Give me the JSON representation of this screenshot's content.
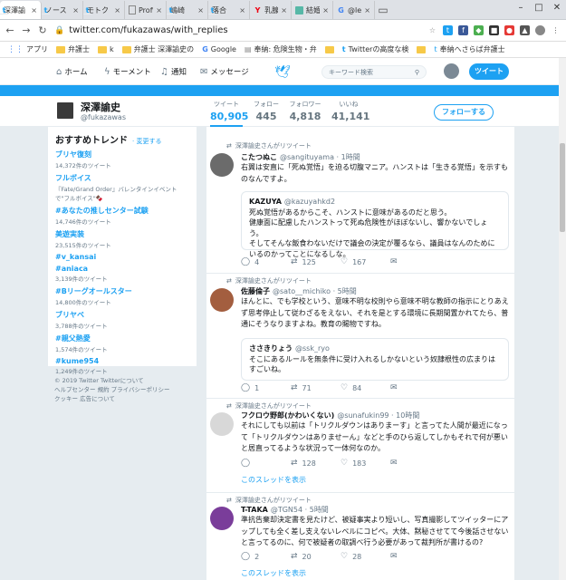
{
  "tabs": [
    {
      "icon": "twitter-icon",
      "label": "深澤諭",
      "active": true
    },
    {
      "icon": "twitter-icon",
      "label": "ノース",
      "active": false
    },
    {
      "icon": "twitter-icon",
      "label": "モトク",
      "active": false
    },
    {
      "icon": "document-icon",
      "label": "Profi",
      "active": false
    },
    {
      "icon": "twitter-icon",
      "label": "嶋崎",
      "active": false
    },
    {
      "icon": "twitter-icon",
      "label": "落合",
      "active": false
    },
    {
      "icon": "yahoo-icon",
      "label": "乳腺",
      "active": false
    },
    {
      "icon": "bookmark-icon",
      "label": "結婚",
      "active": false
    },
    {
      "icon": "google-icon",
      "label": "@lea",
      "active": false
    }
  ],
  "address": {
    "url": "twitter.com/fukazawas/with_replies"
  },
  "bookmarks": [
    {
      "type": "apps",
      "label": "アプリ"
    },
    {
      "type": "folder",
      "label": "弁護士"
    },
    {
      "type": "folder",
      "label": "k"
    },
    {
      "type": "folder",
      "label": "弁護士 深澤諭史の"
    },
    {
      "type": "google",
      "label": "Google"
    },
    {
      "type": "link",
      "label": "奉納: 危険生物・弁"
    },
    {
      "type": "folder",
      "label": ""
    },
    {
      "type": "twitter",
      "label": "Twitterの高度な検"
    },
    {
      "type": "folder",
      "label": ""
    },
    {
      "type": "link",
      "label": "奉納へさらば弁護士"
    }
  ],
  "twnav": {
    "home": "ホーム",
    "moments": "モーメント",
    "notifications": "通知",
    "messages": "メッセージ",
    "search_placeholder": "キーワード検索",
    "tweet_button": "ツイート"
  },
  "profile": {
    "name": "深澤諭史",
    "handle": "@fukazawas",
    "follow_button": "フォローする",
    "stats": [
      {
        "label": "ツイート",
        "value": "80,905"
      },
      {
        "label": "フォロー",
        "value": "445"
      },
      {
        "label": "フォロワー",
        "value": "4,818"
      },
      {
        "label": "いいね",
        "value": "41,141"
      }
    ]
  },
  "trends": {
    "title": "おすすめトレンド",
    "change": "· 変更する",
    "items": [
      {
        "name": "ブリヤ復刻",
        "sub": "14,372件のツイート"
      },
      {
        "name": "フルボイス",
        "sub": "『Fate/Grand Order』バレンタインイベントで\"フルボイス\"🍫"
      },
      {
        "name": "#あなたの推しセンター試験",
        "sub": "14,746件のツイート"
      },
      {
        "name": "美遊実装",
        "sub": "23,515件のツイート"
      },
      {
        "name": "#v_kansai",
        "sub": ""
      },
      {
        "name": "#aniaca",
        "sub": "3,139件のツイート"
      },
      {
        "name": "#Bリーグオールスター",
        "sub": "14,800件のツイート"
      },
      {
        "name": "ブリヤベ",
        "sub": "3,788件のツイート"
      },
      {
        "name": "#親父熱愛",
        "sub": "1,574件のツイート"
      },
      {
        "name": "#kume954",
        "sub": "1,249件のツイート"
      }
    ]
  },
  "footer": {
    "line1": "© 2019 Twitter  Twitterについて",
    "line2": "ヘルプセンター  規約  プライバシーポリシー",
    "line3": "クッキー  広告について"
  },
  "tweets": [
    {
      "retweet_label": "深澤諭史さんがリツイート",
      "name": "こたつぬこ",
      "handle": "@sangituyama · 1時間",
      "text": "右翼は安直に「死ぬ覚悟」を迫る切腹マニア。ハンストは「生きる覚悟」を示すものなんですよ。",
      "quote": {
        "name": "KAZUYA",
        "handle": "@kazuyahkd2",
        "text": "死ぬ覚悟があるからこそ、ハンストに意味があるのだと思う。\n健康面に配慮したハンストって死ぬ危険性がほぼないし、響かないでしょう。\nそしてそんな飯食わないだけで議会の決定が覆るなら、議員はなんのためにいるのかってことになるしな。"
      },
      "replies": "4",
      "retweets": "125",
      "likes": "167",
      "thread": ""
    },
    {
      "retweet_label": "深澤諭史さんがリツイート",
      "name": "佐藤倫子",
      "handle": "@sato__michiko · 5時間",
      "text": "ほんとに、でも学校という、意味不明な校則やら意味不明な教師の指示にとりあえず思考停止して従わざるをえない、それを是とする環境に長期間置かれてたら、普通にそうなりますよね。教育の賜物ですね。",
      "quote": {
        "name": "ささきりょう",
        "handle": "@ssk_ryo",
        "text": "そこにあるルールを無条件に受け入れるしかないという奴隷根性の広まりはすごいね。"
      },
      "replies": "1",
      "retweets": "71",
      "likes": "84",
      "thread": ""
    },
    {
      "retweet_label": "深澤諭史さんがリツイート",
      "name": "フクロウ野郎(かわいくない)",
      "handle": "@sunafukin99 · 10時間",
      "text": "それにしても以前は「トリクルダウンはありまーす」と言ってた人間が最近になって「トリクルダウンはありませーん」などと手のひら返してしかもそれで何が悪いと居直ってるような状況って一体何なのか。",
      "quote": null,
      "replies": "",
      "retweets": "128",
      "likes": "183",
      "thread": "このスレッドを表示"
    },
    {
      "retweet_label": "深澤諭史さんがリツイート",
      "name": "T-TAKA",
      "handle": "@TGN54 · 5時間",
      "text": "準抗告棄却決定書を見たけど、被疑事実より短いし、写真撮影してツイッターにアップしても全く差し支えないレベルにコピペ。大体、黙秘させてて今後話させないと言ってるのに、何で被疑者の取調べ行う必要があって裁判所が書けるの?",
      "quote": null,
      "replies": "2",
      "retweets": "20",
      "likes": "28",
      "thread": "このスレッドを表示"
    }
  ]
}
